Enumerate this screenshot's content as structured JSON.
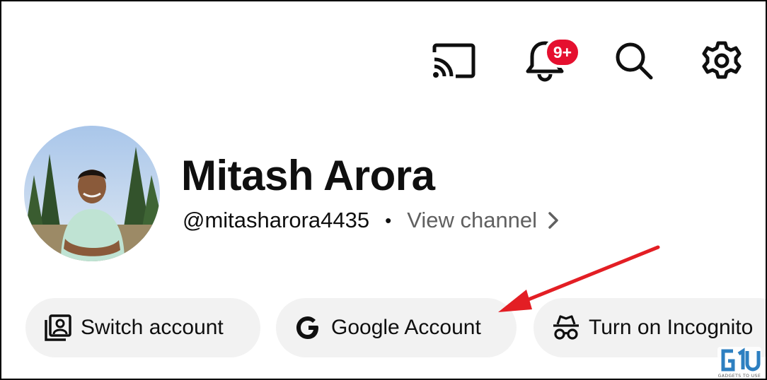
{
  "header": {
    "notifications_badge": "9+",
    "icons": [
      "cast-icon",
      "bell-icon",
      "search-icon",
      "gear-icon"
    ]
  },
  "profile": {
    "name": "Mitash Arora",
    "handle": "@mitasharora4435",
    "separator": "•",
    "view_channel_label": "View channel"
  },
  "chips": [
    {
      "label": "Switch account",
      "icon": "switch-account-icon"
    },
    {
      "label": "Google Account",
      "icon": "google-g-icon"
    },
    {
      "label": "Turn on Incognito",
      "icon": "incognito-icon"
    }
  ],
  "watermark": {
    "subtitle": "GADGETS TO USE"
  },
  "colors": {
    "badge": "#e5102f",
    "chip_bg": "#f2f2f2",
    "annotation_arrow": "#e31e24",
    "secondary_text": "#606060"
  }
}
